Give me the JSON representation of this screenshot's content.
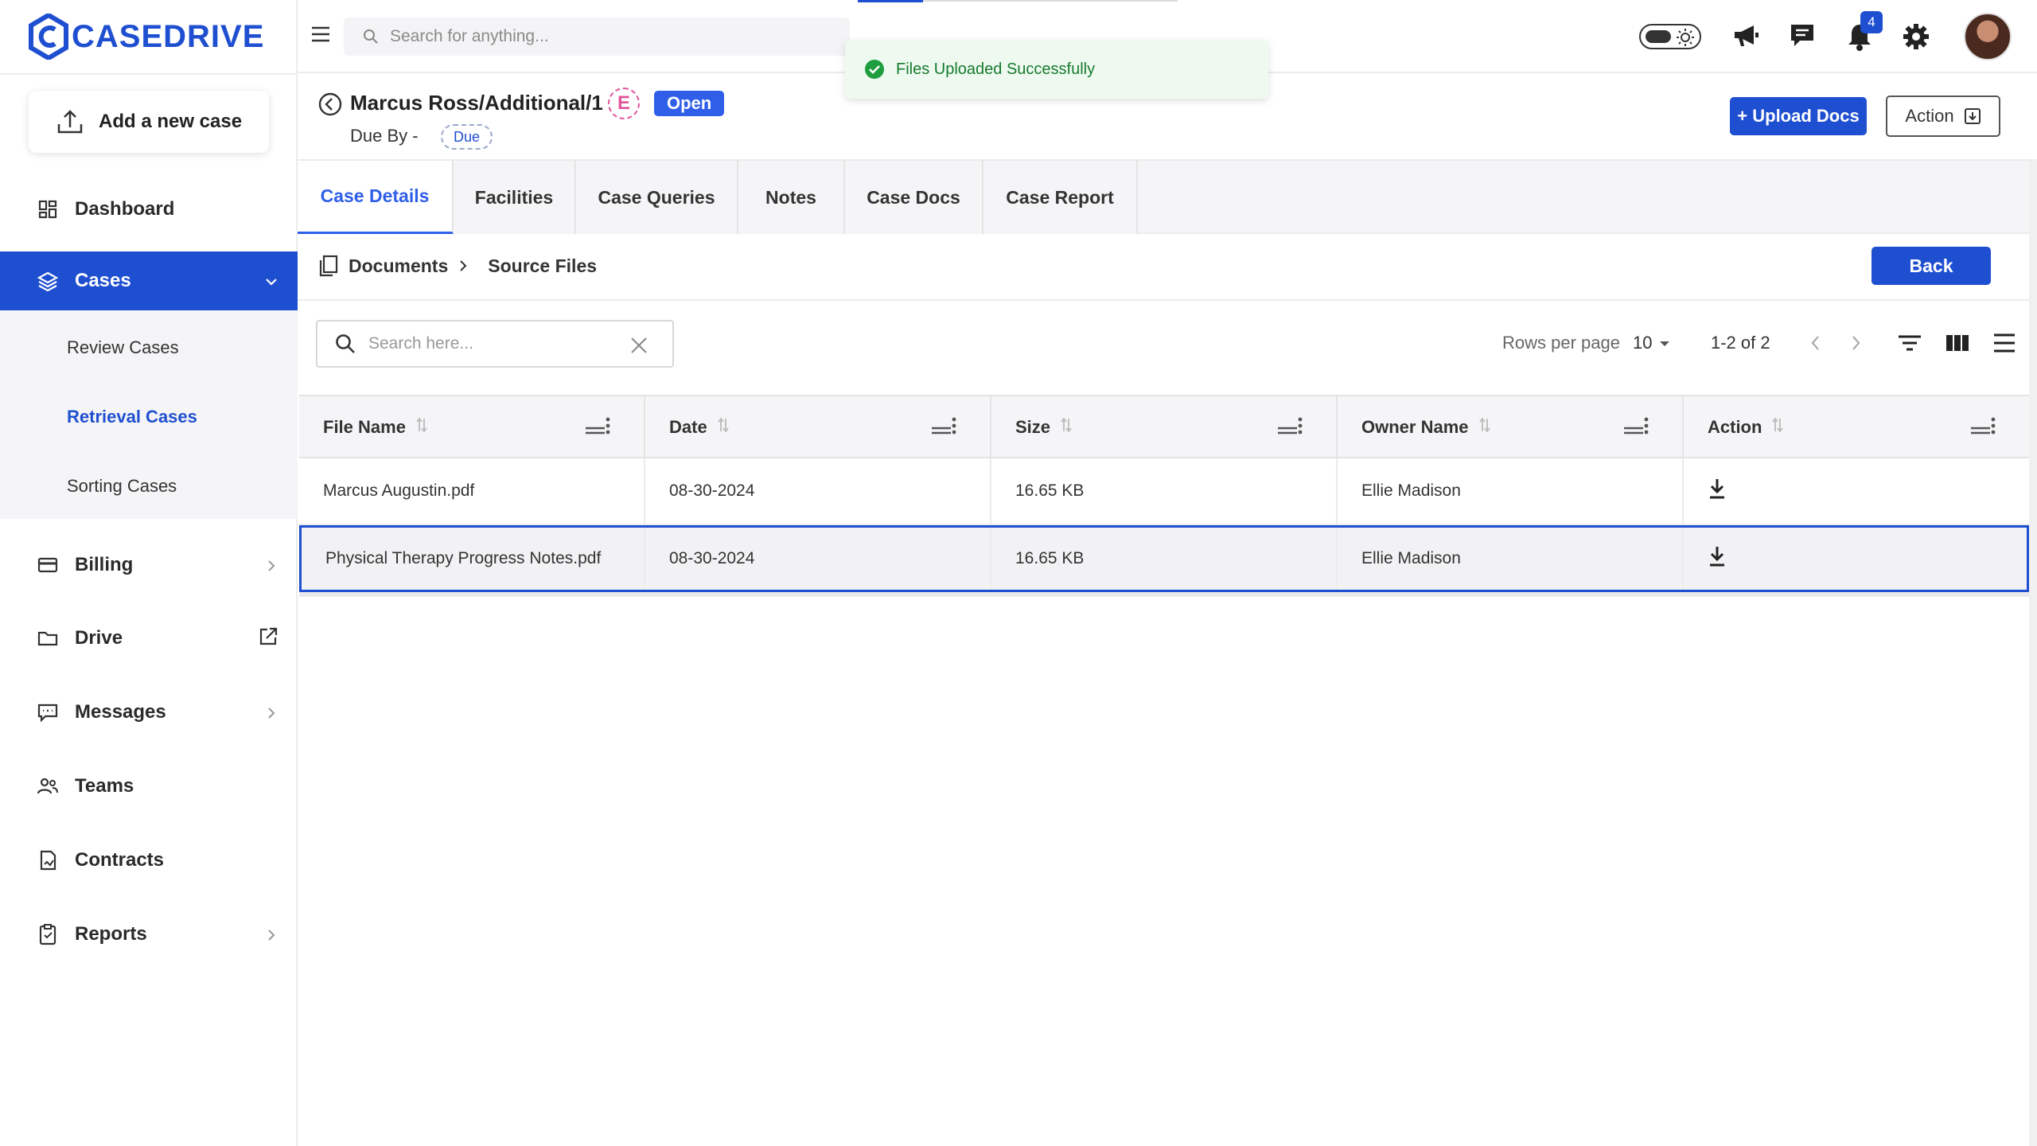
{
  "brand": {
    "name": "CASEDRIVE"
  },
  "sidebar": {
    "add_case_label": "Add a new case",
    "items": [
      {
        "label": "Dashboard"
      },
      {
        "label": "Cases"
      },
      {
        "label": "Billing"
      },
      {
        "label": "Drive"
      },
      {
        "label": "Messages"
      },
      {
        "label": "Teams"
      },
      {
        "label": "Contracts"
      },
      {
        "label": "Reports"
      }
    ],
    "sub_items": [
      {
        "label": "Review Cases"
      },
      {
        "label": "Retrieval Cases"
      },
      {
        "label": "Sorting Cases"
      }
    ]
  },
  "topbar": {
    "search_placeholder": "Search for anything...",
    "notification_count": "4"
  },
  "toast": {
    "message": "Files Uploaded Successfully"
  },
  "case": {
    "title": "Marcus Ross/Additional/1",
    "type_badge": "E",
    "status": "Open",
    "due_label": "Due By -",
    "due_chip": "Due",
    "upload_label": "+ Upload Docs",
    "action_label": "Action"
  },
  "tabs": [
    {
      "label": "Case Details"
    },
    {
      "label": "Facilities"
    },
    {
      "label": "Case Queries"
    },
    {
      "label": "Notes"
    },
    {
      "label": "Case Docs"
    },
    {
      "label": "Case Report"
    }
  ],
  "breadcrumb": {
    "root": "Documents",
    "current": "Source Files",
    "back_label": "Back"
  },
  "toolbar": {
    "search_placeholder": "Search here...",
    "rows_per_page_label": "Rows per page",
    "rows_per_page_value": "10",
    "pagination": "1-2 of 2"
  },
  "table": {
    "columns": [
      {
        "label": "File Name"
      },
      {
        "label": "Date"
      },
      {
        "label": "Size"
      },
      {
        "label": "Owner Name"
      },
      {
        "label": "Action"
      }
    ],
    "rows": [
      {
        "file_name": "Marcus Augustin.pdf",
        "date": "08-30-2024",
        "size": "16.65 KB",
        "owner": "Ellie Madison"
      },
      {
        "file_name": "Physical Therapy Progress Notes.pdf",
        "date": "08-30-2024",
        "size": "16.65 KB",
        "owner": "Ellie Madison"
      }
    ]
  },
  "colors": {
    "brand": "#1f4fd1",
    "accent": "#2f5fe8",
    "success": "#1e9e3e",
    "badge_pink": "#e0559a"
  }
}
